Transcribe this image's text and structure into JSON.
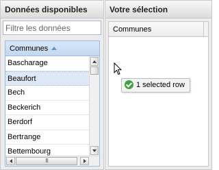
{
  "left_panel": {
    "title": "Données disponibles",
    "filter": {
      "placeholder": "Filtre les données",
      "value": ""
    },
    "column_header": "Communes",
    "sort": "ascending",
    "rows": [
      "Bascharage",
      "Beaufort",
      "Bech",
      "Beckerich",
      "Berdorf",
      "Bertrange",
      "Bettembourg"
    ],
    "selected_row": "Beaufort",
    "hscroll_thumb_grip": "III"
  },
  "right_panel": {
    "title": "Votre sélection",
    "column_header": "Communes"
  },
  "drag_tooltip": {
    "text": "1 selected row",
    "icon": "check-circle-icon"
  },
  "cursor": {
    "icon": "arrow-pointer-icon"
  },
  "colors": {
    "selected_row": "#dfe8f6",
    "grid_header": "#c2d7f0",
    "grid_border": "#99bbe8",
    "check_green": "#3fa33f"
  }
}
